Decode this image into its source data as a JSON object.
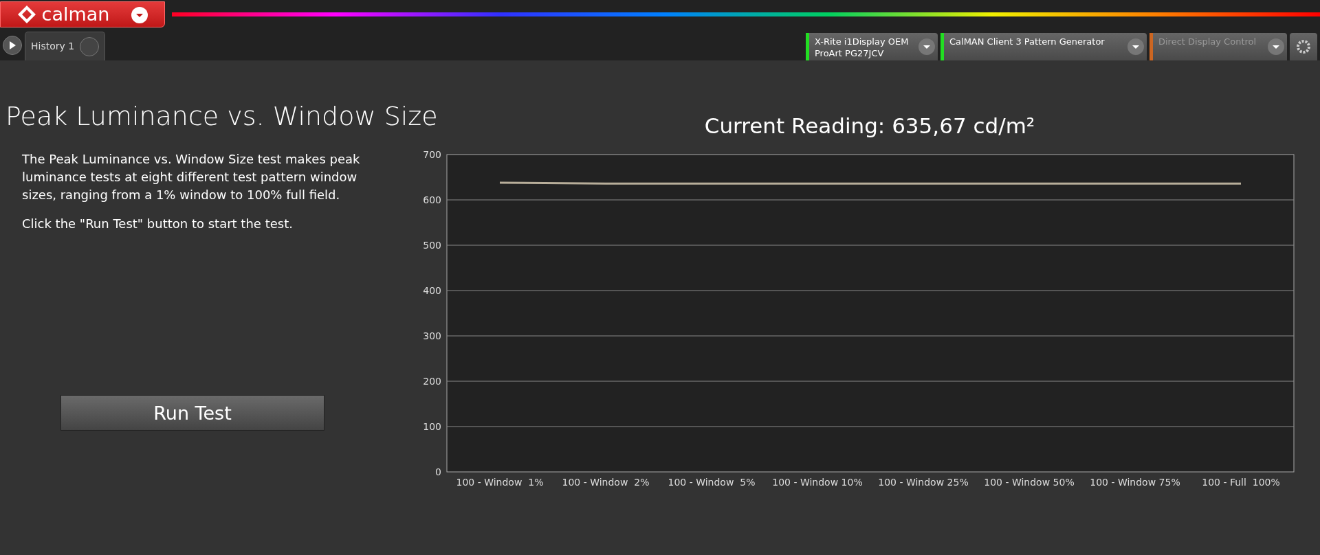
{
  "app": {
    "logo": "calman"
  },
  "tabs": [
    {
      "label": "History 1",
      "selected": true
    }
  ],
  "devices": [
    {
      "lines": [
        "X-Rite i1Display OEM",
        "ProArt PG27JCV"
      ],
      "color": "#22dd22"
    },
    {
      "lines": [
        "CalMAN Client 3 Pattern Generator"
      ],
      "color": "#22dd22"
    },
    {
      "lines": [
        "Direct Display Control"
      ],
      "color": "#cc6622"
    }
  ],
  "page": {
    "title": "Peak Luminance vs. Window Size",
    "description": "The Peak Luminance vs. Window Size test makes peak luminance tests at eight different test pattern window sizes, ranging from a 1% window to 100% full field.",
    "instruction": "Click the \"Run Test\" button to start the test.",
    "run_button": "Run Test",
    "reading": "Current Reading: 635,67 cd/m²"
  },
  "chart": {
    "chart_data": {
      "type": "line",
      "categories": [
        "100 - Window  1%",
        "100 - Window  2%",
        "100 - Window  5%",
        "100 - Window 10%",
        "100 - Window 25%",
        "100 - Window 50%",
        "100 - Window 75%",
        "100 - Full  100%"
      ],
      "series": [
        {
          "color": "#b8ae9a",
          "values": [
            638,
            636,
            636,
            636,
            636,
            636,
            636,
            636
          ]
        }
      ],
      "grid": true,
      "ylim": [
        0,
        700
      ],
      "yticks": [
        0,
        100,
        200,
        300,
        400,
        500,
        600,
        700
      ]
    }
  }
}
